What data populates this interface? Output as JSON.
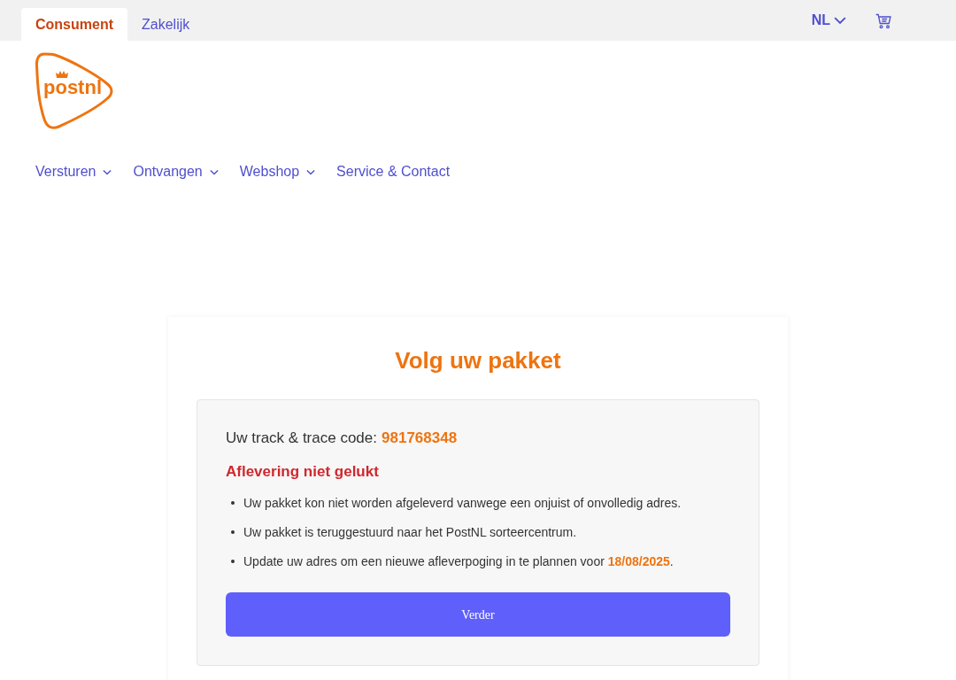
{
  "top_tabs": [
    {
      "label": "Consument",
      "selected": true
    },
    {
      "label": "Zakelijk",
      "selected": false
    }
  ],
  "language": "NL",
  "logo": {
    "text": "postnl"
  },
  "nav": [
    {
      "label": "Versturen",
      "expanded": false,
      "has_menu": true
    },
    {
      "label": "Ontvangen",
      "expanded": false,
      "has_menu": true
    },
    {
      "label": "Webshop",
      "expanded": false,
      "has_menu": true
    },
    {
      "label": "Service & Contact",
      "expanded": false,
      "has_menu": false
    }
  ],
  "card": {
    "title": "Volg uw pakket",
    "track_label": "Uw track & trace code:",
    "track_code": "981768348",
    "status": "Aflevering niet gelukt",
    "items": [
      {
        "text": "Uw pakket kon niet worden afgeleverd vanwege een onjuist of onvolledig adres."
      },
      {
        "text": "Uw pakket is teruggestuurd naar het PostNL sorteercentrum."
      },
      {
        "text": "Update uw adres om een nieuwe afleverpoging in te plannen voor ",
        "highlight": "18/08/2025",
        "suffix": "."
      }
    ],
    "button": "Verder"
  }
}
